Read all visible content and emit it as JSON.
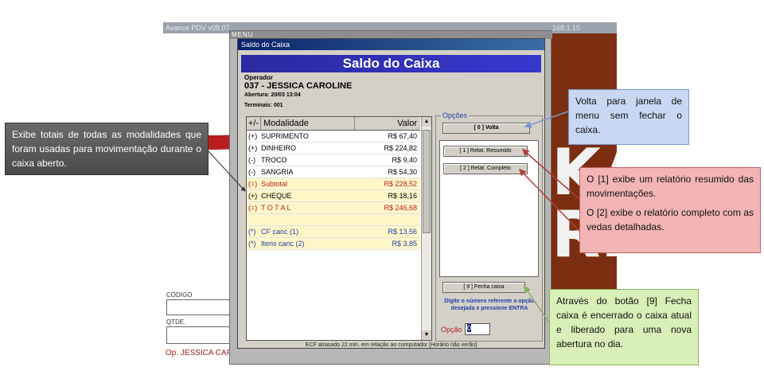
{
  "background_app": {
    "title": "Avance PDV v08.07.",
    "title_tail": "168.1.15",
    "logo_text": [
      "KA",
      "RE"
    ],
    "codigo_label": "CÓDIGO",
    "qtde_label": "QTDE.",
    "operator_text": "Op. JESSICA CAP"
  },
  "menu_window": {
    "title": "MENU"
  },
  "dialog": {
    "window_title": "Saldo do Caixa",
    "header": "Saldo do Caixa",
    "operator_label": "Operador",
    "operator_name": "037 - JESSICA CAROLINE",
    "abertura": "Abertura: 20/03 13:04",
    "terminais": "Terminais: 001",
    "table": {
      "headers": [
        "+/-",
        "Modalidade",
        "Valor"
      ],
      "rows": [
        {
          "sign": "(+)",
          "modalidade": "SUPRIMENTO",
          "valor": "R$ 67,40",
          "style": "normal"
        },
        {
          "sign": "(+)",
          "modalidade": "DINHEIRO",
          "valor": "R$ 224,82",
          "style": "normal"
        },
        {
          "sign": "(-)",
          "modalidade": "TROCO",
          "valor": "R$ 9,40",
          "style": "normal"
        },
        {
          "sign": "(-)",
          "modalidade": "SANGRIA",
          "valor": "R$ 54,30",
          "style": "normal"
        },
        {
          "sign": "(=)",
          "modalidade": "Subtotal",
          "valor": "R$ 228,52",
          "style": "subtotal"
        },
        {
          "sign": "(+)",
          "modalidade": "CHEQUE",
          "valor": "R$ 18,16",
          "style": "highlight"
        },
        {
          "sign": "(=)",
          "modalidade": "T O T A L",
          "valor": "R$ 246,68",
          "style": "total"
        },
        {
          "sign": "",
          "modalidade": "",
          "valor": "",
          "style": "blank"
        },
        {
          "sign": "(*)",
          "modalidade": "CF canc (1)",
          "valor": "R$ 13,56",
          "style": "cancel"
        },
        {
          "sign": "(*)",
          "modalidade": "Itens canc (2)",
          "valor": "R$ 3,85",
          "style": "cancel"
        }
      ]
    },
    "options": {
      "legend": "Opções",
      "volta_button": "[ 0 ]   Volta",
      "resumido_button": "[ 1 ]  Relat. Resumido",
      "completo_button": "[ 2 ]  Relat. Completo",
      "fecha_button": "[ 9 ]  Fecha caixa",
      "hint": "Digite o número referente a opção desejada e pressione ENTRA",
      "opcao_label": "Opção",
      "opcao_value": "0"
    },
    "status_bar": "ECF atrasado 22 min. em relação ao computador [Horário não verão]"
  },
  "callouts": {
    "left": "Exibe totais de todas as modalidades que foram usadas para movimentação durante o caixa aberto.",
    "volta": "Volta para janela de menu sem fechar o caixa.",
    "relat_1": "O [1] exibe um relatório resumido das movimentações.",
    "relat_2": "O [2] exibe o relatório completo com as vedas detalhadas.",
    "fecha": "Através do botão [9] Fecha caixa é encerrado o caixa atual e liberado para uma nova abertura no dia."
  },
  "colors": {
    "dialog_header": "#2a2aa0",
    "subtotal_row": "#fff6c8",
    "total_text": "#b22222",
    "callout_dark": "#555555",
    "callout_blue": "#c8d8f2",
    "callout_red": "#f2b4b4",
    "callout_green": "#d8efb8"
  }
}
